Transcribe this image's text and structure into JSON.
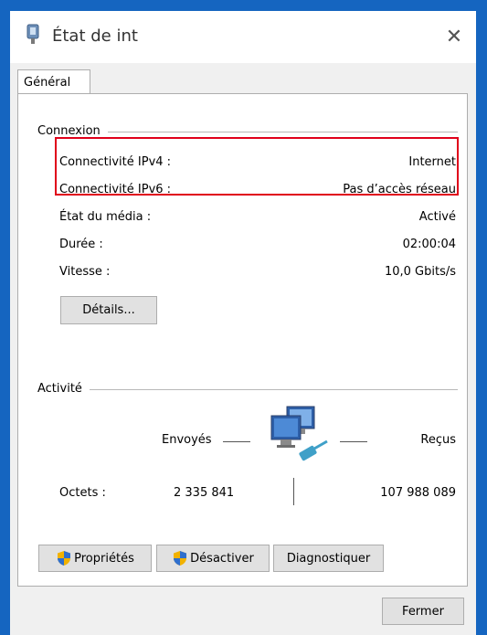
{
  "window": {
    "title": "État de int",
    "close_glyph": "✕"
  },
  "tabs": [
    {
      "label": "Général"
    }
  ],
  "connexion": {
    "heading": "Connexion",
    "rows": [
      {
        "label": "Connectivité IPv4 :",
        "value": "Internet"
      },
      {
        "label": "Connectivité IPv6 :",
        "value": "Pas d’accès réseau"
      },
      {
        "label": "État du média :",
        "value": "Activé"
      },
      {
        "label": "Durée :",
        "value": "02:00:04"
      },
      {
        "label": "Vitesse :",
        "value": "10,0 Gbits/s"
      }
    ],
    "details_button": "Détails..."
  },
  "activite": {
    "heading": "Activité",
    "sent_label": "Envoyés",
    "received_label": "Reçus",
    "bytes_label": "Octets :",
    "bytes_sent": "2 335 841",
    "bytes_received": "107 988 089"
  },
  "buttons": {
    "properties": "Propriétés",
    "disable": "Désactiver",
    "diagnose": "Diagnostiquer",
    "close": "Fermer"
  },
  "colors": {
    "highlight": "#e0001a",
    "accent": "#1565c0"
  },
  "icons": [
    "network-adapter-icon",
    "close-icon",
    "network-activity-icon",
    "uac-shield-icon"
  ]
}
